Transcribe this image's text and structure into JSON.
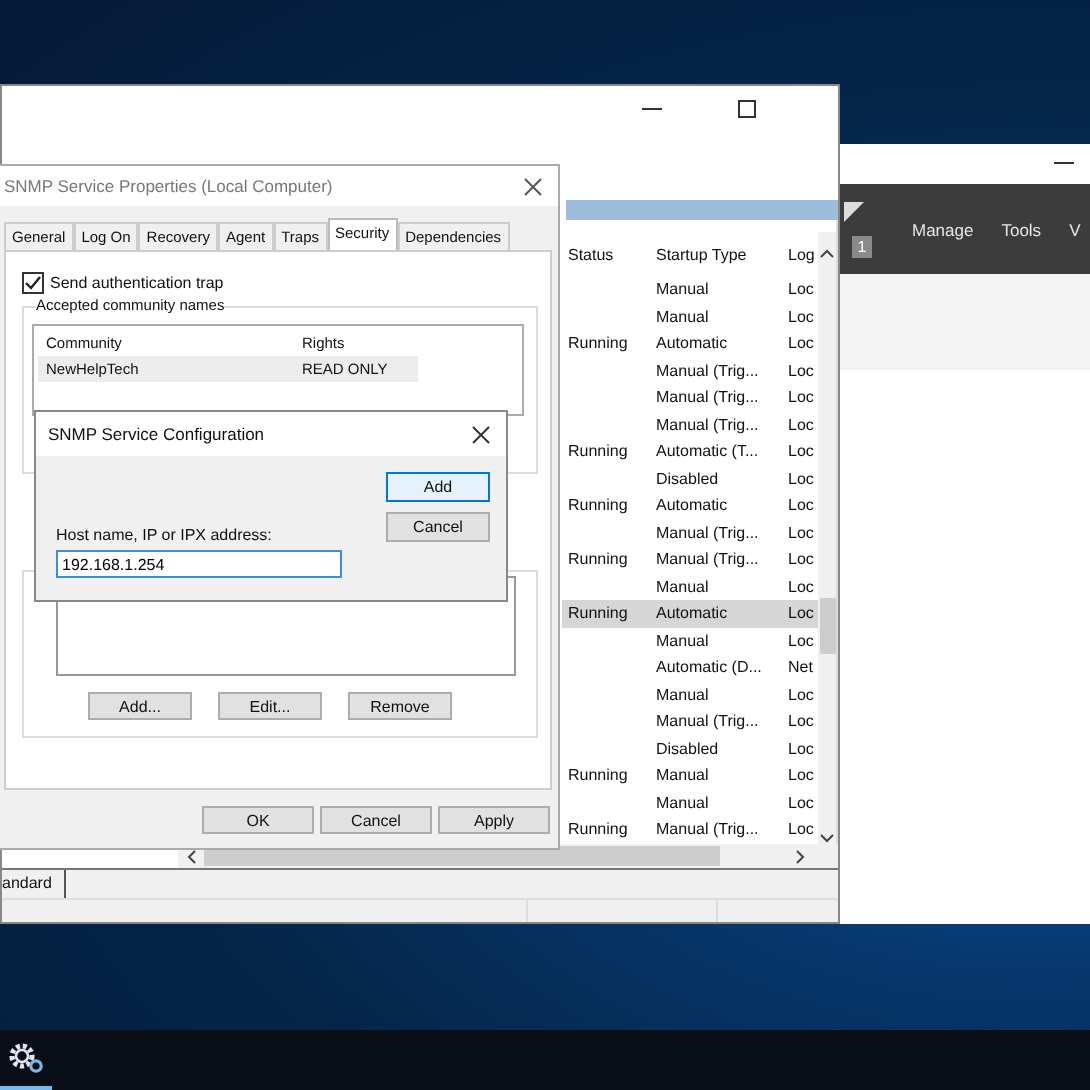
{
  "services_window": {
    "columns": [
      "Status",
      "Startup Type",
      "Log"
    ],
    "rows": [
      {
        "status": "",
        "startup_type": "Manual",
        "log": "Loc",
        "selected": false
      },
      {
        "status": "",
        "startup_type": "Manual",
        "log": "Loc",
        "selected": false
      },
      {
        "status": "Running",
        "startup_type": "Automatic",
        "log": "Loc",
        "selected": false
      },
      {
        "status": "",
        "startup_type": "Manual (Trig...",
        "log": "Loc",
        "selected": false
      },
      {
        "status": "",
        "startup_type": "Manual (Trig...",
        "log": "Loc",
        "selected": false
      },
      {
        "status": "",
        "startup_type": "Manual (Trig...",
        "log": "Loc",
        "selected": false
      },
      {
        "status": "Running",
        "startup_type": "Automatic (T...",
        "log": "Loc",
        "selected": false
      },
      {
        "status": "",
        "startup_type": "Disabled",
        "log": "Loc",
        "selected": false
      },
      {
        "status": "Running",
        "startup_type": "Automatic",
        "log": "Loc",
        "selected": false
      },
      {
        "status": "",
        "startup_type": "Manual (Trig...",
        "log": "Loc",
        "selected": false
      },
      {
        "status": "Running",
        "startup_type": "Manual (Trig...",
        "log": "Loc",
        "selected": false
      },
      {
        "status": "",
        "startup_type": "Manual",
        "log": "Loc",
        "selected": false
      },
      {
        "status": "Running",
        "startup_type": "Automatic",
        "log": "Loc",
        "selected": true
      },
      {
        "status": "",
        "startup_type": "Manual",
        "log": "Loc",
        "selected": false
      },
      {
        "status": "",
        "startup_type": "Automatic (D...",
        "log": "Net",
        "selected": false
      },
      {
        "status": "",
        "startup_type": "Manual",
        "log": "Loc",
        "selected": false
      },
      {
        "status": "",
        "startup_type": "Manual (Trig...",
        "log": "Loc",
        "selected": false
      },
      {
        "status": "",
        "startup_type": "Disabled",
        "log": "Loc",
        "selected": false
      },
      {
        "status": "Running",
        "startup_type": "Manual",
        "log": "Loc",
        "selected": false
      },
      {
        "status": "",
        "startup_type": "Manual",
        "log": "Loc",
        "selected": false
      },
      {
        "status": "Running",
        "startup_type": "Manual (Trig...",
        "log": "Loc",
        "selected": false
      }
    ],
    "view_tab": "andard"
  },
  "server_manager": {
    "badge": "1",
    "menu": [
      "Manage",
      "Tools",
      "V"
    ]
  },
  "properties_dialog": {
    "title": "SNMP Service Properties (Local Computer)",
    "tabs": [
      {
        "label": "General",
        "selected": false
      },
      {
        "label": "Log On",
        "selected": false
      },
      {
        "label": "Recovery",
        "selected": false
      },
      {
        "label": "Agent",
        "selected": false
      },
      {
        "label": "Traps",
        "selected": false
      },
      {
        "label": "Security",
        "selected": true
      },
      {
        "label": "Dependencies",
        "selected": false
      }
    ],
    "send_auth_trap": {
      "label": "Send authentication trap",
      "checked": true
    },
    "community_group": {
      "label": "Accepted community names",
      "columns": [
        "Community",
        "Rights"
      ],
      "rows": [
        {
          "community": "NewHelpTech",
          "rights": "READ ONLY",
          "selected": true
        }
      ]
    },
    "host_buttons": [
      "Add...",
      "Edit...",
      "Remove"
    ],
    "buttons": [
      "OK",
      "Cancel",
      "Apply"
    ]
  },
  "config_dialog": {
    "title": "SNMP Service Configuration",
    "buttons": [
      {
        "label": "Add",
        "default": true
      },
      {
        "label": "Cancel",
        "default": false
      }
    ],
    "field": {
      "label": "Host name, IP or IPX address:",
      "value": "192.168.1.254"
    }
  }
}
